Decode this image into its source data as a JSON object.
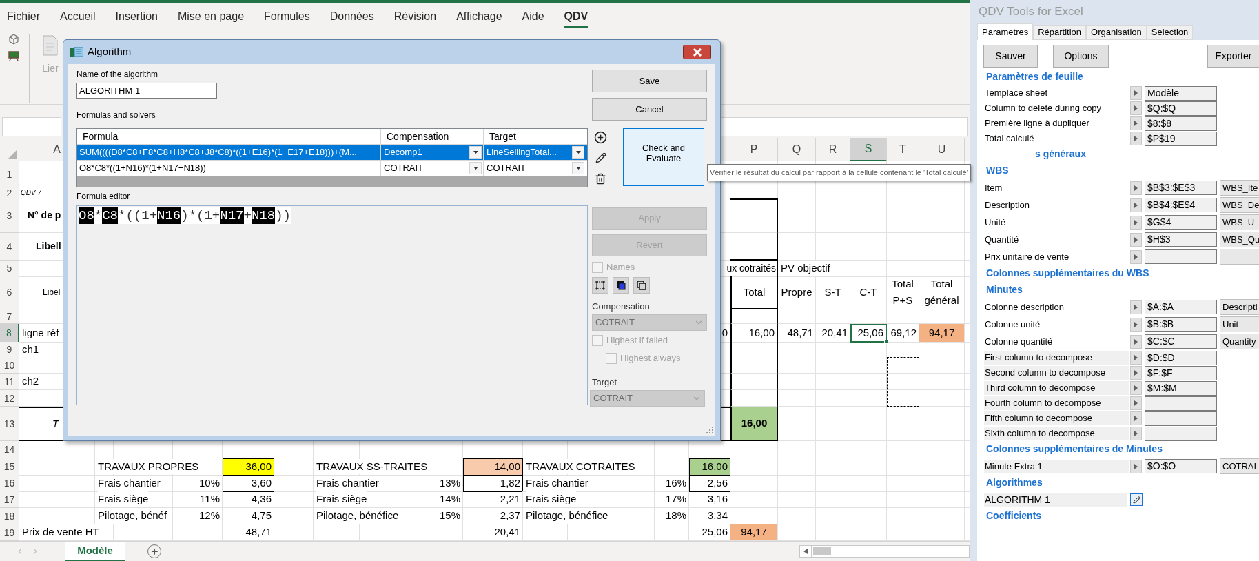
{
  "ribbon": {
    "tabs": [
      {
        "label": "Fichier",
        "selected": false
      },
      {
        "label": "Accueil",
        "selected": false
      },
      {
        "label": "Insertion",
        "selected": false
      },
      {
        "label": "Mise en page",
        "selected": false
      },
      {
        "label": "Formules",
        "selected": false
      },
      {
        "label": "Données",
        "selected": false
      },
      {
        "label": "Révision",
        "selected": false
      },
      {
        "label": "Affichage",
        "selected": false
      },
      {
        "label": "Aide",
        "selected": false
      },
      {
        "label": "QDV",
        "selected": true
      }
    ],
    "link_button": "Lier"
  },
  "sheet": {
    "column_headers": [
      {
        "label": "A",
        "selected": false
      },
      {
        "label": "P",
        "selected": false
      },
      {
        "label": "Q",
        "selected": false
      },
      {
        "label": "R",
        "selected": false
      },
      {
        "label": "S",
        "selected": true
      },
      {
        "label": "T",
        "selected": false
      },
      {
        "label": "U",
        "selected": false
      }
    ],
    "row_headers": [
      {
        "label": "1",
        "selected": false
      },
      {
        "label": "2",
        "selected": false
      },
      {
        "label": "3",
        "selected": false
      },
      {
        "label": "4",
        "selected": false
      },
      {
        "label": "5",
        "selected": false
      },
      {
        "label": "6",
        "selected": false
      },
      {
        "label": "7",
        "selected": false
      },
      {
        "label": "8",
        "selected": true
      },
      {
        "label": "9",
        "selected": false
      },
      {
        "label": "10",
        "selected": false
      },
      {
        "label": "11",
        "selected": false
      },
      {
        "label": "12",
        "selected": false
      },
      {
        "label": "13",
        "selected": false
      },
      {
        "label": "14",
        "selected": false
      },
      {
        "label": "15",
        "selected": false
      },
      {
        "label": "16",
        "selected": false
      },
      {
        "label": "17",
        "selected": false
      },
      {
        "label": "18",
        "selected": false
      },
      {
        "label": "19",
        "selected": false
      }
    ],
    "column_a": {
      "version": "QDV 7",
      "number_label": "N° de p",
      "title_label": "Libell",
      "description_label": "Libel",
      "reference_line": "ligne réf",
      "chapters": [
        "ch1",
        "ch2"
      ],
      "total_label": "T"
    },
    "summary": {
      "group_label": "ux cotraités",
      "target_label": "PV objectif",
      "headers": [
        "Total",
        "Propre",
        "S-T",
        "C-T",
        "Total P+S",
        "Total général"
      ],
      "partial_value": "0",
      "values": [
        {
          "text": "16,00",
          "selected": false
        },
        {
          "text": "48,71",
          "selected": false
        },
        {
          "text": "20,41",
          "selected": false
        },
        {
          "text": "25,06",
          "selected": true
        },
        {
          "text": "69,12",
          "selected": false
        },
        {
          "text": "94,17",
          "selected": false
        }
      ],
      "total": "16,00"
    },
    "blocks": [
      {
        "title": "TRAVAUX PROPRES",
        "total": "36,00",
        "color": "#ffff00",
        "lines": [
          {
            "label": "Frais chantier",
            "rate": "10%",
            "value": "3,60"
          },
          {
            "label": "Frais siège",
            "rate": "11%",
            "value": "4,36"
          },
          {
            "label": "Pilotage, bénéf",
            "rate": "12%",
            "value": "4,75"
          }
        ]
      },
      {
        "title": "TRAVAUX SS-TRAITES",
        "total": "14,00",
        "color": "#f8cbad",
        "lines": [
          {
            "label": "Frais chantier",
            "rate": "13%",
            "value": "1,82"
          },
          {
            "label": "Frais siège",
            "rate": "14%",
            "value": "2,21"
          },
          {
            "label": "Pilotage, bénéfice",
            "rate": "15%",
            "value": "2,37"
          }
        ]
      },
      {
        "title": "TRAVAUX COTRAITES",
        "total": "16,00",
        "color": "#a9d08e",
        "lines": [
          {
            "label": "Frais chantier",
            "rate": "16%",
            "value": "2,56"
          },
          {
            "label": "Frais siège",
            "rate": "17%",
            "value": "3,16"
          },
          {
            "label": "Pilotage, bénéfice",
            "rate": "18%",
            "value": "3,34"
          }
        ]
      }
    ],
    "selling_price": {
      "label": "Prix de vente HT",
      "values": [
        "48,71",
        "20,41",
        "25,06"
      ],
      "grand_total": "94,17"
    },
    "sheet_tabs": [
      {
        "label": "Modèle",
        "selected": true
      }
    ]
  },
  "dialog": {
    "title": "Algorithm",
    "name_label": "Name of the algorithm",
    "name_value": "ALGORITHM 1",
    "save": "Save",
    "cancel": "Cancel",
    "formulas_label": "Formulas and solvers",
    "columns": [
      "Formula",
      "Compensation",
      "Target"
    ],
    "rows": [
      {
        "formula": "SUM((((D8*C8+F8*C8+H8*C8+J8*C8)*((1+E16)*(1+E17+E18)))+(M...",
        "compensation": "Decomp1",
        "target": "LineSellingTotal...",
        "selected": true
      },
      {
        "formula": "O8*C8*((1+N16)*(1+N17+N18))",
        "compensation": "COTRAIT",
        "target": "COTRAIT",
        "selected": false
      }
    ],
    "check_button": "Check and Evaluate",
    "editor_label": "Formula editor",
    "editor_tokens": [
      {
        "text": "O8",
        "kind": "reference"
      },
      {
        "text": "*",
        "kind": "operator"
      },
      {
        "text": "C8",
        "kind": "reference"
      },
      {
        "text": "*((1+",
        "kind": "operator"
      },
      {
        "text": "N16",
        "kind": "reference"
      },
      {
        "text": ")*(1+",
        "kind": "operator"
      },
      {
        "text": "N17",
        "kind": "reference"
      },
      {
        "text": "+",
        "kind": "operator"
      },
      {
        "text": "N18",
        "kind": "reference"
      },
      {
        "text": "))",
        "kind": "operator"
      }
    ],
    "apply": {
      "label": "Apply",
      "disabled": true
    },
    "revert": {
      "label": "Revert",
      "disabled": true
    },
    "names": {
      "label": "Names",
      "checked": false,
      "disabled": true
    },
    "compensation": {
      "label": "Compensation",
      "value": "COTRAIT",
      "disabled": true
    },
    "highest_if_failed": {
      "label": "Highest if failed",
      "checked": false,
      "disabled": true
    },
    "highest_always": {
      "label": "Highest always",
      "checked": false,
      "disabled": true
    },
    "target": {
      "label": "Target",
      "value": "COTRAIT",
      "disabled": true
    }
  },
  "tooltip": "Vérifier le résultat du calcul par rapport à la cellule contenant le 'Total calculé'",
  "panel": {
    "title": "QDV Tools for Excel",
    "tabs": [
      {
        "label": "Parametres",
        "selected": true
      },
      {
        "label": "Répartition",
        "selected": false
      },
      {
        "label": "Organisation",
        "selected": false
      },
      {
        "label": "Selection",
        "selected": false
      }
    ],
    "buttons": [
      "Sauver",
      "Options",
      "Exporter"
    ],
    "items": [
      {
        "kind": "heading",
        "text": "Paramètres de feuille"
      },
      {
        "kind": "field",
        "label": "Templace sheet",
        "value": "Modèle",
        "shaded": false
      },
      {
        "kind": "field",
        "label": "Column to delete during copy",
        "value": "$Q:$Q",
        "shaded": false
      },
      {
        "kind": "field",
        "label": "Première ligne à dupliquer",
        "value": "$8:$8",
        "shaded": false
      },
      {
        "kind": "field",
        "label": "Total calculé",
        "value": "$P$19",
        "shaded": false
      },
      {
        "kind": "partial_heading",
        "text": "s généraux"
      },
      {
        "kind": "heading",
        "text": "WBS"
      },
      {
        "kind": "field_extra",
        "label": "Item",
        "value": "$B$3:$E$3",
        "extra": "WBS_Ite",
        "shaded": false
      },
      {
        "kind": "field_extra",
        "label": "Description",
        "value": "$B$4:$E$4",
        "extra": "WBS_De",
        "shaded": false
      },
      {
        "kind": "field_extra",
        "label": "Unité",
        "value": "$G$4",
        "extra": "WBS_U",
        "shaded": false
      },
      {
        "kind": "field_extra",
        "label": "Quantité",
        "value": "$H$3",
        "extra": "WBS_Qu",
        "shaded": false
      },
      {
        "kind": "field_extra",
        "label": "Prix unitaire de vente",
        "shaded": false
      },
      {
        "kind": "heading",
        "text": "Colonnes supplémentaires du WBS"
      },
      {
        "kind": "heading",
        "text": "Minutes"
      },
      {
        "kind": "field_extra",
        "label": "Colonne description",
        "value": "$A:$A",
        "extra": "Descripti",
        "shaded": false
      },
      {
        "kind": "field_extra",
        "label": "Colonne unité",
        "value": "$B:$B",
        "extra": "Unit",
        "shaded": false
      },
      {
        "kind": "field_extra",
        "label": "Colonne quantité",
        "value": "$C:$C",
        "extra": "Quantity",
        "shaded": false
      },
      {
        "kind": "field",
        "label": "First column to decompose",
        "value": "$D:$D",
        "shaded": true
      },
      {
        "kind": "field",
        "label": "Second column to decompose",
        "value": "$F:$F",
        "shaded": true
      },
      {
        "kind": "field",
        "label": "Third column to decompose",
        "value": "$M:$M",
        "shaded": true
      },
      {
        "kind": "field",
        "label": "Fourth column to decompose",
        "shaded": true
      },
      {
        "kind": "field",
        "label": "Fifth column to decompose",
        "shaded": true
      },
      {
        "kind": "field",
        "label": "Sixth column to decompose",
        "shaded": true
      },
      {
        "kind": "heading",
        "text": "Colonnes supplémentaires de Minutes"
      },
      {
        "kind": "field_extra",
        "label": "Minute Extra 1",
        "value": "$O:$O",
        "extra": "COTRAI",
        "shaded": true
      },
      {
        "kind": "heading",
        "text": "Algorithmes"
      },
      {
        "kind": "algorithm",
        "label": "ALGORITHM 1"
      },
      {
        "kind": "heading",
        "text": "Coefficients"
      }
    ]
  }
}
